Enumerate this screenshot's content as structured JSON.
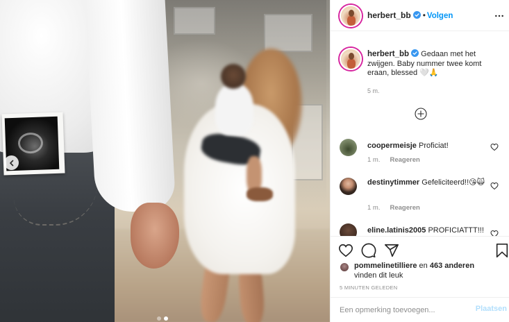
{
  "colors": {
    "accent": "#0095f6",
    "verified": "#3897f0",
    "secondary_text": "#8e8e8e",
    "primary_text": "#262626",
    "post_disabled": "#b2dffc"
  },
  "photo": {
    "carousel_prev_icon": "chevron-left-icon",
    "dots_count": 2,
    "active_dot": 1
  },
  "header": {
    "username": "herbert_bb",
    "separator": "•",
    "follow_label": "Volgen",
    "more_icon": "more-horizontal-icon"
  },
  "caption": {
    "username": "herbert_bb",
    "text": "Gedaan met het zwijgen. Baby nummer twee komt eraan, blessed 🤍🙏",
    "time": "5 m."
  },
  "load_more_icon": "plus-circle-icon",
  "comments": [
    {
      "username": "coopermeisje",
      "text": "Proficiat!",
      "time": "",
      "reply_label": ""
    },
    {
      "username": "destinytimmer",
      "text": "Gefeliciteerd!!😘🙀",
      "time": "1 m.",
      "reply_label": "Reageren"
    },
    {
      "username": "eline.latinis2005",
      "text": "PROFICIATTT!!!",
      "time": "1 m.",
      "reply_label": "Reageren"
    }
  ],
  "first_comment_meta": {
    "time": "1 m.",
    "reply_label": "Reageren"
  },
  "actions": {
    "like_icon": "heart-icon",
    "comment_icon": "comment-icon",
    "share_icon": "send-icon",
    "save_icon": "bookmark-icon"
  },
  "likes": {
    "user": "pommelinetilliere",
    "rest": " en ",
    "count": "463 anderen",
    "suffix": "vinden dit leuk"
  },
  "posted_time": "5 MINUTEN GELEDEN",
  "add_comment": {
    "placeholder": "Een opmerking toevoegen...",
    "post_label": "Plaatsen"
  }
}
